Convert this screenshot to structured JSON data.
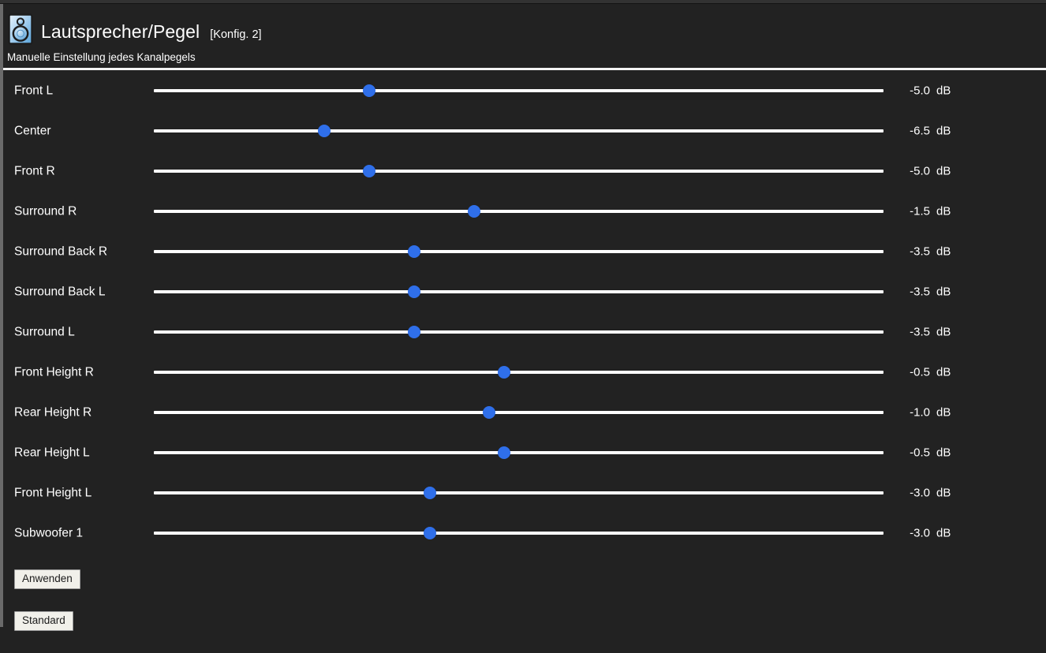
{
  "window": {
    "background_color": "#222222",
    "top_bar_color": "#323232",
    "left_rail_color": "#6a6a6a"
  },
  "header": {
    "icon": "speaker-icon",
    "title": "Lautsprecher/Pegel",
    "config_tag": "[Konfig. 2]",
    "subtitle": "Manuelle Einstellung jedes Kanalpegels",
    "divider_color": "#f4f4f4"
  },
  "slider_style": {
    "track_color": "#ffffff",
    "thumb_color": "#2f6fea",
    "min_db": -12.0,
    "max_db": 12.0
  },
  "channels": [
    {
      "label": "Front L",
      "value": "-5.0",
      "unit": "dB",
      "percent": 29.5
    },
    {
      "label": "Center",
      "value": "-6.5",
      "unit": "dB",
      "percent": 23.3
    },
    {
      "label": "Front R",
      "value": "-5.0",
      "unit": "dB",
      "percent": 29.5
    },
    {
      "label": "Surround R",
      "value": "-1.5",
      "unit": "dB",
      "percent": 43.9
    },
    {
      "label": "Surround Back R",
      "value": "-3.5",
      "unit": "dB",
      "percent": 35.7
    },
    {
      "label": "Surround Back L",
      "value": "-3.5",
      "unit": "dB",
      "percent": 35.7
    },
    {
      "label": "Surround L",
      "value": "-3.5",
      "unit": "dB",
      "percent": 35.7
    },
    {
      "label": "Front Height R",
      "value": "-0.5",
      "unit": "dB",
      "percent": 48.0
    },
    {
      "label": "Rear Height R",
      "value": "-1.0",
      "unit": "dB",
      "percent": 45.9
    },
    {
      "label": "Rear Height L",
      "value": "-0.5",
      "unit": "dB",
      "percent": 48.0
    },
    {
      "label": "Front Height L",
      "value": "-3.0",
      "unit": "dB",
      "percent": 37.8
    },
    {
      "label": "Subwoofer 1",
      "value": "-3.0",
      "unit": "dB",
      "percent": 37.8
    }
  ],
  "actions": {
    "apply_label": "Anwenden",
    "default_label": "Standard"
  }
}
